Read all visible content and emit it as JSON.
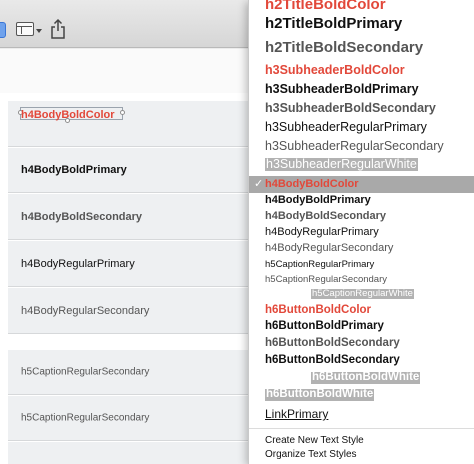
{
  "toolbar": {
    "icons": [
      "sidebar-toggle-icon",
      "layout-icon",
      "share-icon"
    ]
  },
  "canvas": {
    "rows": [
      {
        "label": "h4BodyBoldColor"
      },
      {
        "label": "h4BodyBoldPrimary"
      },
      {
        "label": "h4BodyBoldSecondary"
      },
      {
        "label": "h4BodyRegularPrimary"
      },
      {
        "label": "h4BodyRegularSecondary"
      },
      {
        "label": "h5CaptionRegularSecondary"
      },
      {
        "label": "h5CaptionRegularSecondary"
      }
    ]
  },
  "menu": {
    "items": [
      {
        "label": "h2TitleBoldColor"
      },
      {
        "label": "h2TitleBoldPrimary"
      },
      {
        "label": "h2TitleBoldSecondary"
      },
      {
        "label": "h3SubheaderBoldColor"
      },
      {
        "label": "h3SubheaderBoldPrimary"
      },
      {
        "label": "h3SubheaderBoldSecondary"
      },
      {
        "label": "h3SubheaderRegularPrimary"
      },
      {
        "label": "h3SubheaderRegularSecondary"
      },
      {
        "label": "h3SubheaderRegularWhite"
      },
      {
        "label": "h4BodyBoldColor",
        "checked": true
      },
      {
        "label": "h4BodyBoldPrimary"
      },
      {
        "label": "h4BodyBoldSecondary"
      },
      {
        "label": "h4BodyRegularPrimary"
      },
      {
        "label": "h4BodyRegularSecondary"
      },
      {
        "label": "h5CaptionRegularPrimary"
      },
      {
        "label": "h5CaptionRegularSecondary"
      },
      {
        "label": "h5CaptionRegularWhite"
      },
      {
        "label": "h6ButtonBoldColor"
      },
      {
        "label": "h6ButtonBoldPrimary"
      },
      {
        "label": "h6ButtonBoldSecondary"
      },
      {
        "label": "h6ButtonBoldSecondary"
      },
      {
        "label": "h6ButtonBoldWhite"
      },
      {
        "label": "h6ButtonBoldWhite"
      },
      {
        "label": "LinkPrimary"
      }
    ],
    "check_mark": "✓",
    "actions": [
      {
        "label": "Create New Text Style"
      },
      {
        "label": "Organize Text Styles"
      }
    ]
  },
  "colors": {
    "accent_red": "#e2483a",
    "selected_item_bg": "#a9a9a9",
    "white_style_highlight": "#b2b2b2"
  }
}
